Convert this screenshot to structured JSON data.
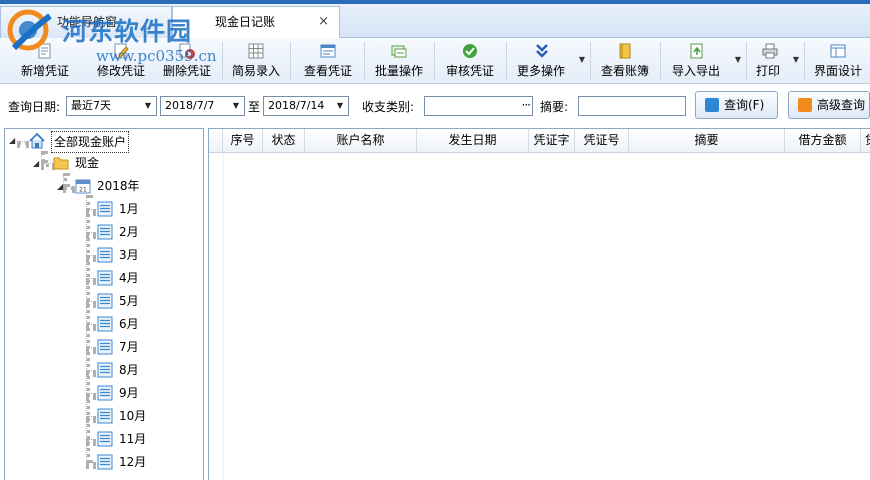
{
  "watermark": {
    "site_name": "河东软件园",
    "url": "www.pc0359.cn"
  },
  "tabs": [
    {
      "label": "功能导航窗",
      "active": false
    },
    {
      "label": "现金日记账",
      "active": true,
      "close": "×"
    }
  ],
  "toolbar": {
    "buttons": [
      {
        "label": "新增凭证",
        "icon": "new-voucher-icon"
      },
      {
        "label": "修改凭证",
        "icon": "edit-voucher-icon"
      },
      {
        "label": "删除凭证",
        "icon": "delete-voucher-icon"
      },
      {
        "label": "简易录入",
        "icon": "grid-icon"
      },
      {
        "label": "查看凭证",
        "icon": "view-voucher-icon"
      },
      {
        "label": "批量操作",
        "icon": "batch-icon"
      },
      {
        "label": "审核凭证",
        "icon": "check-icon"
      },
      {
        "label": "更多操作",
        "icon": "double-chevron-down-icon"
      },
      {
        "label": "查看账簿",
        "icon": "book-icon"
      },
      {
        "label": "导入导出",
        "icon": "import-export-icon"
      },
      {
        "label": "打印",
        "icon": "printer-icon"
      },
      {
        "label": "界面设计",
        "icon": "layout-icon"
      }
    ]
  },
  "query": {
    "date_label": "查询日期:",
    "date_range_value": "最近7天",
    "start_date": "2018/7/7",
    "to_label": "至",
    "end_date": "2018/7/14",
    "category_label": "收支类别:",
    "category_value": "",
    "category_dots": "···",
    "summary_label": "摘要:",
    "summary_value": "",
    "search_button": "查询(F)",
    "advanced_button": "高级查询"
  },
  "tree": {
    "root": "全部现金账户",
    "account": "现金",
    "year": "2018年",
    "months": [
      "1月",
      "2月",
      "3月",
      "4月",
      "5月",
      "6月",
      "7月",
      "8月",
      "9月",
      "10月",
      "11月",
      "12月"
    ]
  },
  "grid": {
    "columns": [
      "序号",
      "状态",
      "账户名称",
      "发生日期",
      "凭证字",
      "凭证号",
      "摘要",
      "借方金额",
      "贷"
    ]
  },
  "colors": {
    "accent": "#2b6cb8",
    "folder": "#f3c64b",
    "border": "#8ea7c6"
  }
}
